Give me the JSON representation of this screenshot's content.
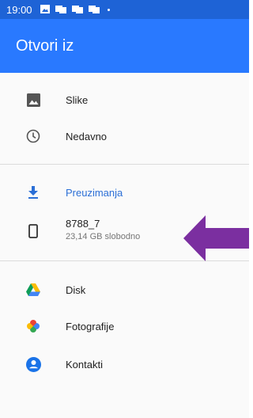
{
  "status_bar": {
    "time": "19:00",
    "icons": [
      "image-icon",
      "notification-icon",
      "notification-icon",
      "notification-icon",
      "dot-icon"
    ]
  },
  "app_bar": {
    "title": "Otvori iz"
  },
  "drawer": {
    "items": [
      {
        "label": "Slike",
        "icon": "image-icon"
      },
      {
        "label": "Nedavno",
        "icon": "clock-icon"
      },
      {
        "label": "Preuzimanja",
        "icon": "download-icon",
        "selected": true,
        "color": "#2b6fd6"
      },
      {
        "label": "8788_7",
        "sublabel": "23,14 GB slobodno",
        "icon": "phone-icon"
      },
      {
        "label": "Disk",
        "icon": "drive-icon"
      },
      {
        "label": "Fotografije",
        "icon": "photos-icon"
      },
      {
        "label": "Kontakti",
        "icon": "contacts-icon"
      }
    ]
  },
  "annotation": {
    "arrow_color": "#7b2fa0",
    "arrow_direction": "left"
  },
  "colors": {
    "status_bar": "#1e63d6",
    "app_bar": "#2979ff",
    "accent": "#2b6fd6",
    "background": "#fafafa"
  }
}
